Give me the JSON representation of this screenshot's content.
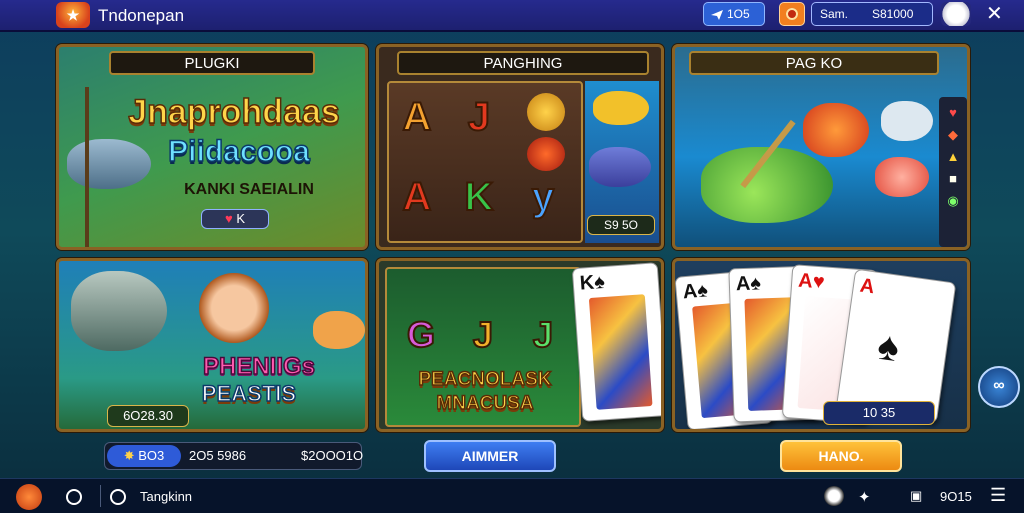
{
  "header": {
    "app_title": "Tndonepan",
    "share_label": "1O5",
    "account_label": "Sam.",
    "balance": "S81000"
  },
  "tiles": {
    "top_left_banner": "PLUGKI",
    "top_left_title_1": "Jnaprohdaas",
    "top_left_title_2": "Piidacooa",
    "top_left_sub": "KANKI SAEIALIN",
    "top_left_badge": "K",
    "top_mid_banner": "PANGHING",
    "top_mid_reel_symbols": [
      "A",
      "J",
      "A",
      "K",
      "y"
    ],
    "top_mid_score": "S9 5O",
    "top_right_banner": "PAG KO",
    "mid_left_title_1": "PHENIIGs",
    "mid_left_title_2": "PEASTIS",
    "mid_left_amount": "6O28.30",
    "mid_center_symbols": [
      "G",
      "J",
      "J"
    ],
    "mid_center_title_1": "PEACNOLASK",
    "mid_center_title_2": "MNACUSA",
    "mid_right_amount": "10 35"
  },
  "actions": {
    "bet_label": "BO3",
    "bet_value": "2O5 5986",
    "win_value": "$2OOO1O",
    "primary_button": "AIMMER",
    "secondary_button": "HANO."
  },
  "bottom": {
    "mid_label": "Tangkinn",
    "right_label": "9O15"
  },
  "colors": {
    "accent_blue": "#2e5bd8",
    "accent_gold": "#f2a71f",
    "panel_border": "#8a6224"
  }
}
